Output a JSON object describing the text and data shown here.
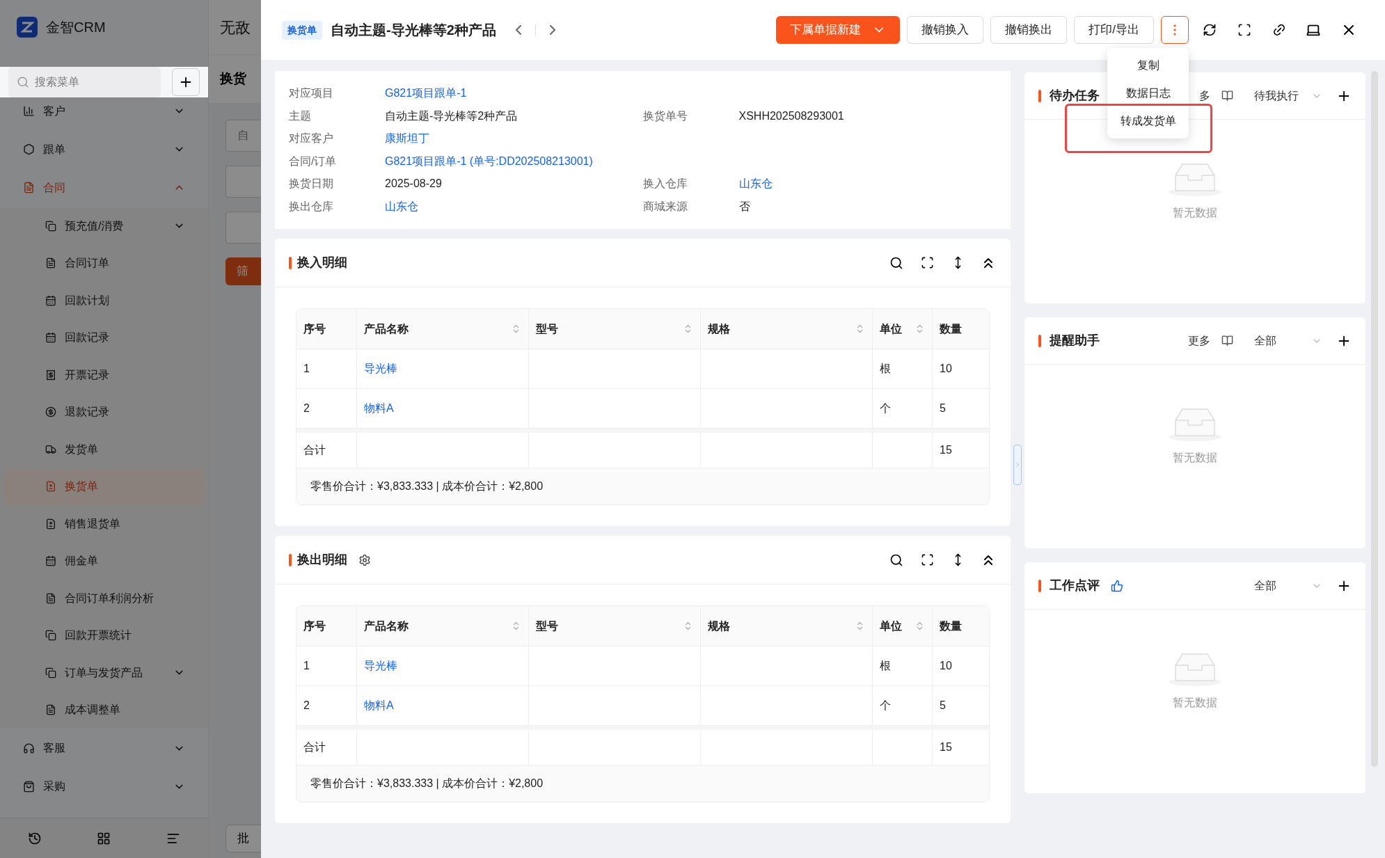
{
  "background": {
    "app_name": "金智CRM",
    "page_title": "无敌",
    "section_title": "换货",
    "search": {
      "placeholder": "搜索菜单"
    },
    "filter_field": {
      "placeholder": "自"
    },
    "filter_button": "筛",
    "bottom_button": "批",
    "menu": [
      {
        "label": "客户",
        "selected": false,
        "expanded": false
      },
      {
        "label": "跟单",
        "selected": false,
        "expanded": false
      },
      {
        "label": "合同",
        "selected": true,
        "expanded": true,
        "children": [
          {
            "label": "预充值/消费",
            "kind": "group",
            "selected": false
          },
          {
            "label": "合同订单",
            "kind": "link",
            "selected": false
          },
          {
            "label": "回款计划",
            "kind": "link",
            "selected": false
          },
          {
            "label": "回款记录",
            "kind": "link",
            "selected": false
          },
          {
            "label": "开票记录",
            "kind": "link",
            "selected": false
          },
          {
            "label": "退款记录",
            "kind": "link",
            "selected": false
          },
          {
            "label": "发货单",
            "kind": "link",
            "selected": false
          },
          {
            "label": "换货单",
            "kind": "link",
            "selected": true
          },
          {
            "label": "销售退货单",
            "kind": "link",
            "selected": false
          },
          {
            "label": "佣金单",
            "kind": "link",
            "selected": false
          },
          {
            "label": "合同订单利润分析",
            "kind": "link",
            "selected": false
          },
          {
            "label": "回款开票统计",
            "kind": "link",
            "selected": false
          },
          {
            "label": "订单与发货产品",
            "kind": "group",
            "selected": false
          },
          {
            "label": "成本调整单",
            "kind": "link",
            "selected": false
          }
        ]
      },
      {
        "label": "客服",
        "selected": false,
        "expanded": false
      },
      {
        "label": "采购",
        "selected": false,
        "expanded": false
      }
    ]
  },
  "drawer": {
    "tag": "换货单",
    "title": "自动主题-导光棒等2种产品",
    "primary_button": "下属单据新建",
    "buttons": [
      "撤销换入",
      "撤销换出",
      "打印/导出"
    ],
    "more_menu": {
      "open": true,
      "items": [
        {
          "label": "复制",
          "highlighted": false
        },
        {
          "label": "数据日志",
          "highlighted": false
        },
        {
          "label": "转成发货单",
          "highlighted": true
        }
      ]
    }
  },
  "info": {
    "rows": [
      [
        {
          "label": "对应项目",
          "value": "G821项目跟单-1",
          "link": true
        }
      ],
      [
        {
          "label": "主题",
          "value": "自动主题-导光棒等2种产品",
          "link": false
        },
        {
          "label": "换货单号",
          "value": "XSHH202508293001",
          "link": false
        }
      ],
      [
        {
          "label": "对应客户",
          "value": "康斯坦丁",
          "link": true
        }
      ],
      [
        {
          "label": "合同/订单",
          "value": "G821项目跟单-1 (单号:DD202508213001)",
          "link": true
        }
      ],
      [
        {
          "label": "换货日期",
          "value": "2025-08-29",
          "link": false
        },
        {
          "label": "换入仓库",
          "value": "山东仓",
          "link": true
        }
      ],
      [
        {
          "label": "换出仓库",
          "value": "山东仓",
          "link": true
        },
        {
          "label": "商城来源",
          "value": "否",
          "link": false
        }
      ]
    ]
  },
  "sections": [
    {
      "title": "换入明细",
      "settings": false,
      "columns": [
        {
          "label": "序号",
          "sortable": false
        },
        {
          "label": "产品名称",
          "sortable": true
        },
        {
          "label": "型号",
          "sortable": true
        },
        {
          "label": "规格",
          "sortable": true
        },
        {
          "label": "单位",
          "sortable": true
        },
        {
          "label": "数量",
          "sortable": false
        }
      ],
      "rows": [
        {
          "index": "1",
          "product": "导光棒",
          "unit": "根",
          "qty": "10"
        },
        {
          "index": "2",
          "product": "物料A",
          "unit": "个",
          "qty": "5"
        }
      ],
      "total": {
        "label": "合计",
        "qty": "15"
      },
      "summary": "零售价合计：¥3,833.333 | 成本价合计：¥2,800"
    },
    {
      "title": "换出明细",
      "settings": true,
      "columns": [
        {
          "label": "序号",
          "sortable": false
        },
        {
          "label": "产品名称",
          "sortable": true
        },
        {
          "label": "型号",
          "sortable": true
        },
        {
          "label": "规格",
          "sortable": true
        },
        {
          "label": "单位",
          "sortable": true
        },
        {
          "label": "数量",
          "sortable": false
        }
      ],
      "rows": [
        {
          "index": "1",
          "product": "导光棒",
          "unit": "根",
          "qty": "10"
        },
        {
          "index": "2",
          "product": "物料A",
          "unit": "个",
          "qty": "5"
        }
      ],
      "total": {
        "label": "合计",
        "qty": "15"
      },
      "summary": "零售价合计：¥3,833.333 | 成本价合计：¥2,800"
    }
  ],
  "widgets": [
    {
      "title": "待办任务",
      "more": "多",
      "filter": "待我执行",
      "empty": "暂无数据"
    },
    {
      "title": "提醒助手",
      "more": "更多",
      "filter": "全部",
      "thumb": false,
      "empty": "暂无数据"
    },
    {
      "title": "工作点评",
      "filter": "全部",
      "thumb": true,
      "empty": "暂无数据"
    }
  ]
}
